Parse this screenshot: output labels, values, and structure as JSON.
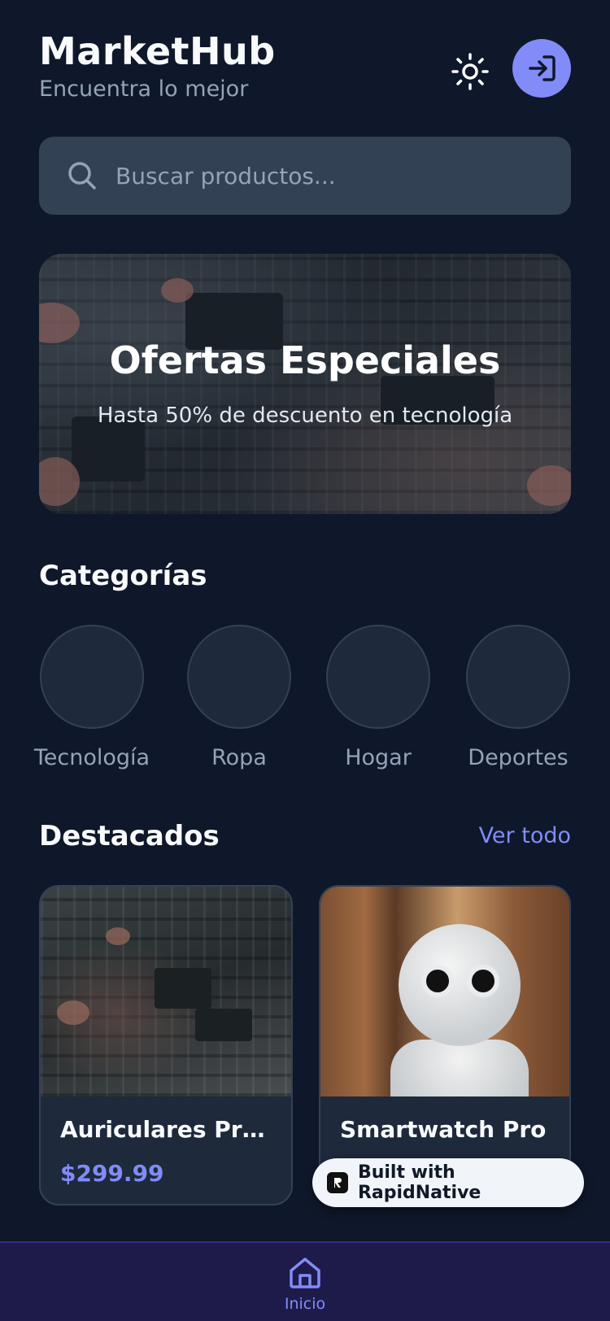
{
  "header": {
    "title": "MarketHub",
    "subtitle": "Encuentra lo mejor",
    "theme_icon": "sun-icon",
    "login_icon": "login-arrow-icon"
  },
  "search": {
    "placeholder": "Buscar productos..."
  },
  "banner": {
    "title": "Ofertas Especiales",
    "subtitle": "Hasta 50% de descuento en tecnología"
  },
  "categories": {
    "title": "Categorías",
    "items": [
      {
        "label": "Tecnología"
      },
      {
        "label": "Ropa"
      },
      {
        "label": "Hogar"
      },
      {
        "label": "Deportes"
      }
    ]
  },
  "featured": {
    "title": "Destacados",
    "see_all": "Ver todo",
    "products": [
      {
        "name": "Auriculares Pre...",
        "price": "$299.99"
      },
      {
        "name": "Smartwatch Pro",
        "price": ""
      }
    ]
  },
  "badge": {
    "text": "Built with RapidNative"
  },
  "tabbar": {
    "items": [
      {
        "label": "Inicio",
        "icon": "home-icon"
      }
    ]
  },
  "colors": {
    "background": "#0f172a",
    "surface": "#1e293b",
    "accent": "#818cf8",
    "tabbar": "#1e1b4b"
  }
}
